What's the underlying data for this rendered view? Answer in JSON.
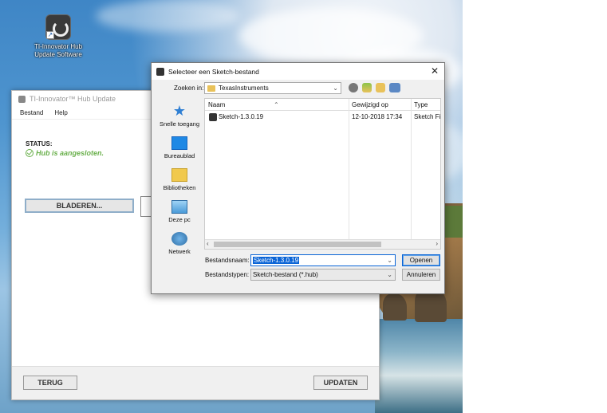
{
  "desktop": {
    "icon_label": "TI-Innovator Hub Update Software"
  },
  "hub_window": {
    "title": "TI-Innovator™ Hub Update",
    "menu": [
      "Bestand",
      "Help"
    ],
    "status_heading": "STATUS:",
    "status_value": "Hub is aangesloten.",
    "browse_button": "BLADEREN...",
    "back_button": "TERUG",
    "update_button": "UPDATEN"
  },
  "dialog": {
    "title": "Selecteer een Sketch-bestand",
    "look_in_label": "Zoeken in:",
    "look_in_value": "TexasInstruments",
    "places": [
      "Snelle toegang",
      "Bureaublad",
      "Bibliotheken",
      "Deze pc",
      "Netwerk"
    ],
    "columns": {
      "name": "Naam",
      "modified": "Gewijzigd op",
      "type": "Type"
    },
    "files": [
      {
        "name": "Sketch-1.3.0.19",
        "modified": "12-10-2018 17:34",
        "type": "Sketch File"
      }
    ],
    "filename_label": "Bestandsnaam:",
    "filename_value": "Sketch-1.3.0.19",
    "filetype_label": "Bestandstypen:",
    "filetype_value": "Sketch-bestand (*.hub)",
    "open_button": "Openen",
    "cancel_button": "Annuleren"
  },
  "icons": [
    "refresh-app-icon",
    "close-icon",
    "folder-icon",
    "back-icon",
    "up-folder-icon",
    "new-folder-icon",
    "view-menu-icon",
    "quick-access-icon",
    "desktop-icon",
    "libraries-icon",
    "this-pc-icon",
    "network-icon",
    "check-circle-icon"
  ]
}
